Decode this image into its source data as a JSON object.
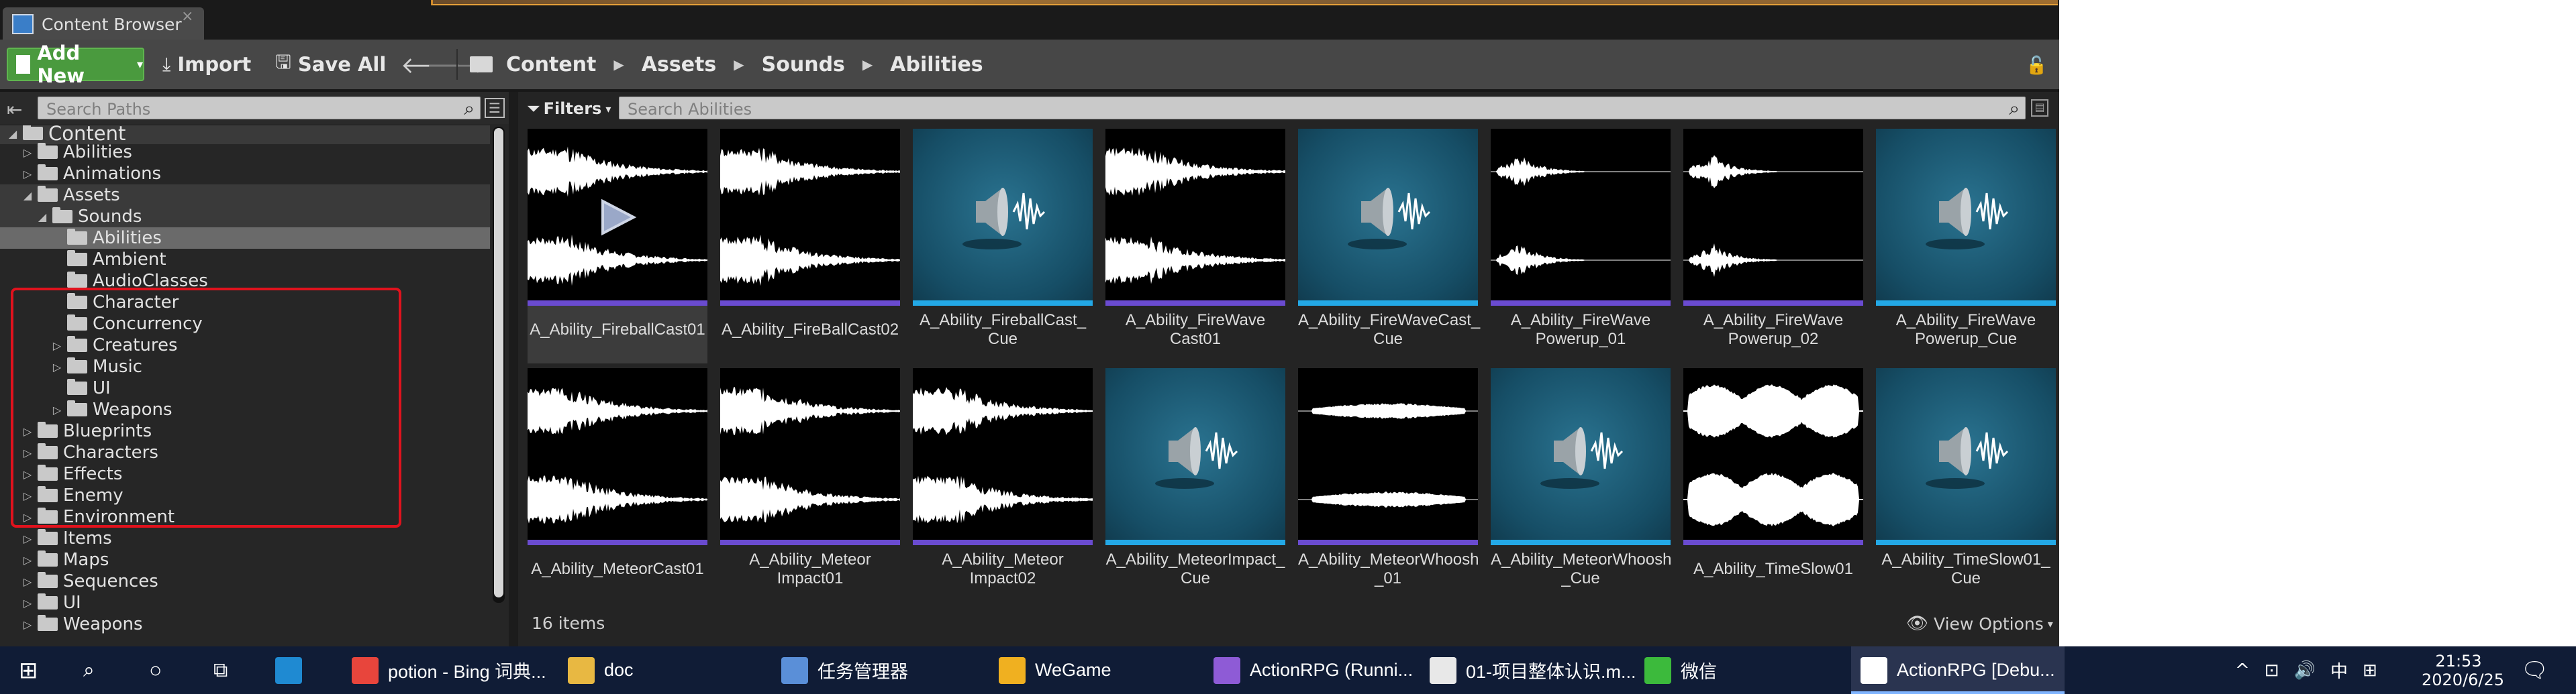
{
  "window": {
    "tab_title": "Content Browser",
    "tab_close": "×"
  },
  "toolbar": {
    "add_new_label": "Add New",
    "import_label": "Import",
    "save_all_label": "Save All",
    "breadcrumb": [
      "Content",
      "Assets",
      "Sounds",
      "Abilities"
    ],
    "breadcrumb_sep": "▶"
  },
  "paths": {
    "search_placeholder": "Search Paths",
    "tree": [
      {
        "label": "Content",
        "depth": 0,
        "arrow": "◢",
        "style": "grp"
      },
      {
        "label": "Abilities",
        "depth": 1,
        "arrow": "▷",
        "style": ""
      },
      {
        "label": "Animations",
        "depth": 1,
        "arrow": "▷",
        "style": ""
      },
      {
        "label": "Assets",
        "depth": 1,
        "arrow": "◢",
        "style": "grp"
      },
      {
        "label": "Sounds",
        "depth": 2,
        "arrow": "◢",
        "style": "grp"
      },
      {
        "label": "Abilities",
        "depth": 3,
        "arrow": "",
        "style": "sel"
      },
      {
        "label": "Ambient",
        "depth": 3,
        "arrow": "",
        "style": ""
      },
      {
        "label": "AudioClasses",
        "depth": 3,
        "arrow": "",
        "style": ""
      },
      {
        "label": "Character",
        "depth": 3,
        "arrow": "",
        "style": ""
      },
      {
        "label": "Concurrency",
        "depth": 3,
        "arrow": "",
        "style": ""
      },
      {
        "label": "Creatures",
        "depth": 3,
        "arrow": "▷",
        "style": ""
      },
      {
        "label": "Music",
        "depth": 3,
        "arrow": "▷",
        "style": ""
      },
      {
        "label": "UI",
        "depth": 3,
        "arrow": "",
        "style": ""
      },
      {
        "label": "Weapons",
        "depth": 3,
        "arrow": "▷",
        "style": ""
      },
      {
        "label": "Blueprints",
        "depth": 1,
        "arrow": "▷",
        "style": ""
      },
      {
        "label": "Characters",
        "depth": 1,
        "arrow": "▷",
        "style": ""
      },
      {
        "label": "Effects",
        "depth": 1,
        "arrow": "▷",
        "style": ""
      },
      {
        "label": "Enemy",
        "depth": 1,
        "arrow": "▷",
        "style": ""
      },
      {
        "label": "Environment",
        "depth": 1,
        "arrow": "▷",
        "style": ""
      },
      {
        "label": "Items",
        "depth": 1,
        "arrow": "▷",
        "style": ""
      },
      {
        "label": "Maps",
        "depth": 1,
        "arrow": "▷",
        "style": ""
      },
      {
        "label": "Sequences",
        "depth": 1,
        "arrow": "▷",
        "style": ""
      },
      {
        "label": "UI",
        "depth": 1,
        "arrow": "▷",
        "style": ""
      },
      {
        "label": "Weapons",
        "depth": 1,
        "arrow": "▷",
        "style": ""
      }
    ]
  },
  "assets": {
    "filters_label": "Filters",
    "search_placeholder": "Search Abilities",
    "item_count": "16 items",
    "view_options": "View Options",
    "items": [
      {
        "name": "A_Ability_FireballCast01",
        "kind": "wave",
        "shape": "dense",
        "selected": true
      },
      {
        "name": "A_Ability_FireBallCast02",
        "kind": "wave",
        "shape": "dense",
        "selected": false
      },
      {
        "name": "A_Ability_FireballCast_\nCue",
        "kind": "cue",
        "selected": false
      },
      {
        "name": "A_Ability_FireWave\nCast01",
        "kind": "wave",
        "shape": "dense",
        "selected": false
      },
      {
        "name": "A_Ability_FireWaveCast_\nCue",
        "kind": "cue",
        "selected": false
      },
      {
        "name": "A_Ability_FireWave\nPowerup_01",
        "kind": "wave",
        "shape": "short",
        "selected": false
      },
      {
        "name": "A_Ability_FireWave\nPowerup_02",
        "kind": "wave",
        "shape": "short",
        "selected": false
      },
      {
        "name": "A_Ability_FireWave\nPowerup_Cue",
        "kind": "cue",
        "selected": false
      },
      {
        "name": "A_Ability_MeteorCast01",
        "kind": "wave",
        "shape": "dense",
        "selected": false
      },
      {
        "name": "A_Ability_Meteor\nImpact01",
        "kind": "wave",
        "shape": "dense",
        "selected": false
      },
      {
        "name": "A_Ability_Meteor\nImpact02",
        "kind": "wave",
        "shape": "dense",
        "selected": false
      },
      {
        "name": "A_Ability_MeteorImpact_\nCue",
        "kind": "cue",
        "selected": false
      },
      {
        "name": "A_Ability_MeteorWhoosh\n_01",
        "kind": "wave",
        "shape": "thin",
        "selected": false
      },
      {
        "name": "A_Ability_MeteorWhoosh\n_Cue",
        "kind": "cue",
        "selected": false
      },
      {
        "name": "A_Ability_TimeSlow01",
        "kind": "wave",
        "shape": "blob",
        "selected": false
      },
      {
        "name": "A_Ability_TimeSlow01_\nCue",
        "kind": "cue",
        "selected": false
      }
    ]
  },
  "taskbar": {
    "apps": [
      {
        "label": "potion - Bing 词典...",
        "icon_color": "#e8453c",
        "icon": "chrome-icon"
      },
      {
        "label": "doc",
        "icon_color": "#e8b842",
        "icon": "folder-icon"
      },
      {
        "label": "任务管理器",
        "icon_color": "#5a8fd8",
        "icon": "task-manager-icon"
      },
      {
        "label": "WeGame",
        "icon_color": "#f0b020",
        "icon": "wegame-icon"
      },
      {
        "label": "ActionRPG (Runni...",
        "icon_color": "#8e5bd6",
        "icon": "visual-studio-icon"
      },
      {
        "label": "01-项目整体认识.m...",
        "icon_color": "#e8e8e8",
        "icon": "typora-icon"
      },
      {
        "label": "微信",
        "icon_color": "#3cba3c",
        "icon": "wechat-icon"
      },
      {
        "label": "ActionRPG [Debu...",
        "icon_color": "#ffffff",
        "icon": "unreal-icon"
      }
    ],
    "tray": [
      "^",
      "⊡",
      "🔊",
      "中",
      "⊞"
    ],
    "time": "21:53",
    "date": "2020/6/25"
  }
}
